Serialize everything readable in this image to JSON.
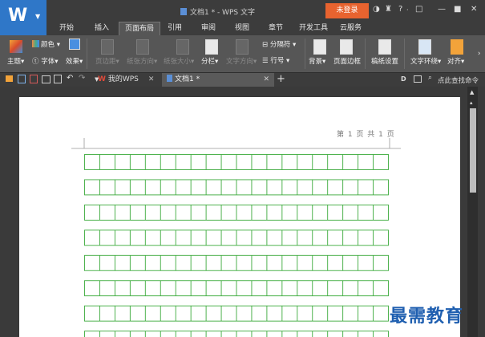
{
  "window": {
    "title": "文档1 * - WPS 文字",
    "login_label": "未登录",
    "logo_letter": "W"
  },
  "tabs": [
    "开始",
    "插入",
    "页面布局",
    "引用",
    "审阅",
    "视图",
    "章节",
    "开发工具",
    "云服务"
  ],
  "active_tab": "页面布局",
  "ribbon": {
    "theme": "主题",
    "color": "颜色",
    "font": "字体",
    "effect": "效果",
    "margin": "页边距",
    "orientation": "纸张方向",
    "size": "纸张大小",
    "columns": "分栏",
    "text_direction": "文字方向",
    "separator": "分隔符",
    "line_number": "行号",
    "background": "背景",
    "page_border": "页面边框",
    "manuscript": "稿纸设置",
    "text_wrap": "文字环绕",
    "align": "对齐"
  },
  "doc_tabs": {
    "mywps": "我的WPS",
    "doc": "文档1 *"
  },
  "search_placeholder": "点此查找命令",
  "page": {
    "header": "第 1 页 共 1 页"
  },
  "watermark": "最需教育",
  "colors": {
    "grid": "#3caa3c",
    "accent": "#e8632f",
    "brand": "#2f77c8"
  }
}
